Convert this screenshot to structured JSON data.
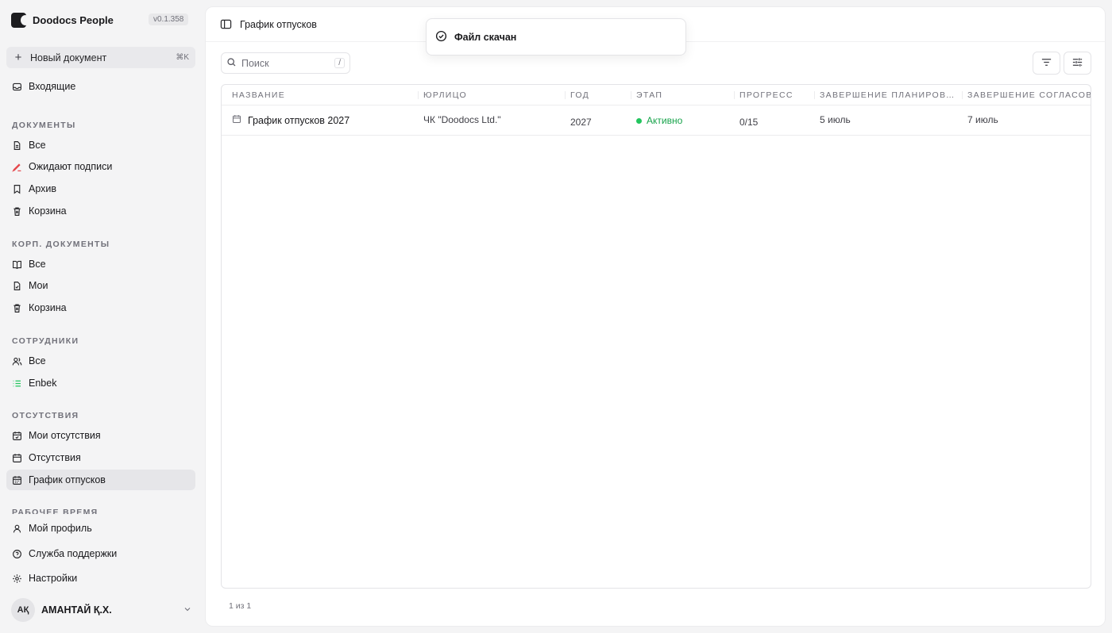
{
  "app": {
    "name": "Doodocs People",
    "version": "v0.1.358"
  },
  "new_document": {
    "label": "Новый документ",
    "shortcut": "⌘K"
  },
  "nav": {
    "inbox": "Входящие",
    "documents": {
      "title": "ДОКУМЕНТЫ",
      "items": [
        "Все",
        "Ожидают подписи",
        "Архив",
        "Корзина"
      ]
    },
    "corp_documents": {
      "title": "КОРП. ДОКУМЕНТЫ",
      "items": [
        "Все",
        "Мои",
        "Корзина"
      ]
    },
    "employees": {
      "title": "СОТРУДНИКИ",
      "items": [
        "Все",
        "Enbek"
      ]
    },
    "absences": {
      "title": "ОТСУТСТВИЯ",
      "items": [
        "Мои отсутствия",
        "Отсутствия",
        "График отпусков"
      ]
    },
    "worktime": {
      "title": "РАБОЧЕЕ ВРЕМЯ"
    },
    "bottom": [
      "Мой профиль",
      "Служба поддержки",
      "Настройки"
    ]
  },
  "user": {
    "initials": "AҚ",
    "name": "АМАНТАЙ Қ.Х."
  },
  "page": {
    "title": "График отпусков"
  },
  "search": {
    "placeholder": "Поиск",
    "shortcut": "/"
  },
  "table": {
    "columns": [
      "НАЗВАНИЕ",
      "ЮРЛИЦО",
      "ГОД",
      "ЭТАП",
      "ПРОГРЕСС",
      "ЗАВЕРШЕНИЕ ПЛАНИРОВАНИЯ",
      "ЗАВЕРШЕНИЕ СОГЛАСОВАНИЯ"
    ],
    "rows": [
      {
        "name": "График отпусков 2027",
        "entity": "ЧК \"Doodocs Ltd.\"",
        "year": "2027",
        "stage": "Активно",
        "progress": "0/15",
        "planning_end": "5 июль",
        "approval_end": "7 июль"
      }
    ]
  },
  "pagination": {
    "text": "1 из 1"
  },
  "toast": {
    "message": "Файл скачан"
  },
  "colors": {
    "accent_green": "#22c55e",
    "sidebar_bg": "#f4f4f5",
    "active_bg": "#e6e6e9",
    "pending_icon": "#e5484d",
    "enbek_icon": "#22c55e"
  }
}
